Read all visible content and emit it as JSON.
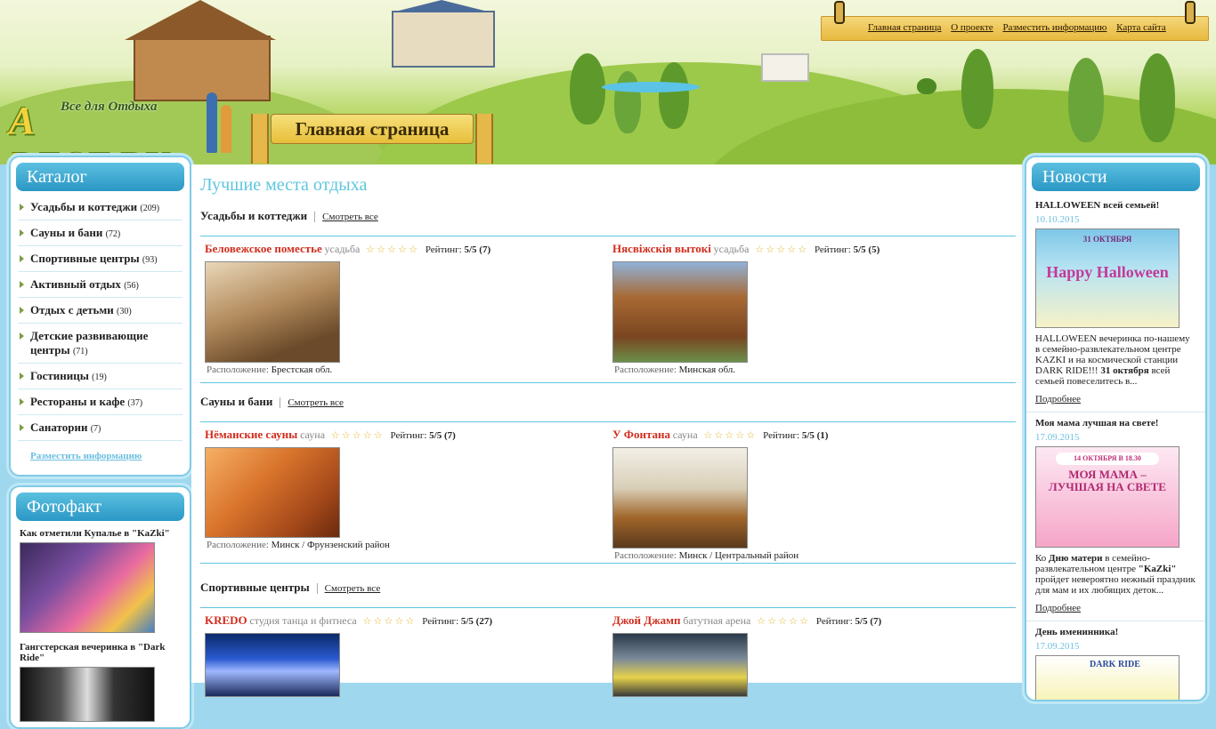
{
  "header": {
    "logo_text": "A REST.BY",
    "slogan": "Все для Отдыха",
    "banner_title": "Главная страница",
    "top_nav": [
      "Главная страница",
      "О проекте",
      "Разместить информацию",
      "Карта сайта"
    ]
  },
  "catalog": {
    "title": "Каталог",
    "items": [
      {
        "label": "Усадьбы и коттеджи",
        "count": "(209)"
      },
      {
        "label": "Сауны и бани",
        "count": "(72)"
      },
      {
        "label": "Спортивные центры",
        "count": "(93)"
      },
      {
        "label": "Активный отдых",
        "count": "(56)"
      },
      {
        "label": "Отдых с детьми",
        "count": "(30)"
      },
      {
        "label": "Детские развивающие центры",
        "count": "(71)"
      },
      {
        "label": "Гостиницы",
        "count": "(19)"
      },
      {
        "label": "Рестораны и кафе",
        "count": "(37)"
      },
      {
        "label": "Санатории",
        "count": "(7)"
      }
    ],
    "add_info": "Разместить информацию"
  },
  "photofact": {
    "title": "Фотофакт",
    "items": [
      {
        "title": "Как отметили Купалье в \"KaZki\""
      },
      {
        "title": "Гангстерская вечеринка в \"Dark Ride\""
      }
    ]
  },
  "main": {
    "title": "Лучшие места отдыха",
    "see_all": "Смотреть все",
    "rating_label": "Рейтинг:",
    "location_label": "Расположение:",
    "sections": [
      {
        "title": "Усадьбы и коттеджи",
        "cards": [
          {
            "name": "Беловежское поместье",
            "type": "усадьба",
            "rating": "5/5 (7)",
            "location": "Брестская обл."
          },
          {
            "name": "Нясвіжскія вытокі",
            "type": "усадьба",
            "rating": "5/5 (5)",
            "location": "Минская обл."
          }
        ]
      },
      {
        "title": "Сауны и бани",
        "cards": [
          {
            "name": "Нёманские сауны",
            "type": "сауна",
            "rating": "5/5 (7)",
            "location": "Минск / Фрунзенский район"
          },
          {
            "name": "У Фонтана",
            "type": "сауна",
            "rating": "5/5 (1)",
            "location": "Минск / Центральный район"
          }
        ]
      },
      {
        "title": "Спортивные центры",
        "cards": [
          {
            "name": "KREDO",
            "type": "студия танца и фитнеса",
            "rating": "5/5 (27)",
            "location": ""
          },
          {
            "name": "Джой Джамп",
            "type": "батутная арена",
            "rating": "5/5 (7)",
            "location": ""
          }
        ]
      }
    ]
  },
  "news": {
    "title": "Новости",
    "more_label": "Подробнее",
    "items": [
      {
        "title": "HALLOWEEN всей семьей!",
        "date": "10.10.2015",
        "text_a": "HALLOWEEN вечеринка по-нашему в семейно-развлекательном центре KAZKI и на космической станции DARK RIDE!!! ",
        "text_b": "31 октября",
        "text_c": " всей семьей повеселитесь в...",
        "img_top": "31 ОКТЯБРЯ",
        "img_main": "Happy Halloween"
      },
      {
        "title": "Моя мама лучшая на свете!",
        "date": "17.09.2015",
        "text_a": "Ко ",
        "text_b": "Дню матери",
        "text_c": " в семейно-развлекательном центре ",
        "text_d": "\"KaZki\"",
        "text_e": " пройдет невероятно нежный праздник для мам и их любящих деток...",
        "img_top": "14 ОКТЯБРЯ В 18.30",
        "img_main": "МОЯ МАМА – ЛУЧШАЯ НА СВЕТЕ"
      },
      {
        "title": "День именинника!",
        "date": "17.09.2015",
        "img_main": "DARK RIDE"
      }
    ]
  },
  "colors": {
    "accent": "#5ec6de",
    "title_red": "#d12c1c",
    "star": "#e3b52a"
  }
}
